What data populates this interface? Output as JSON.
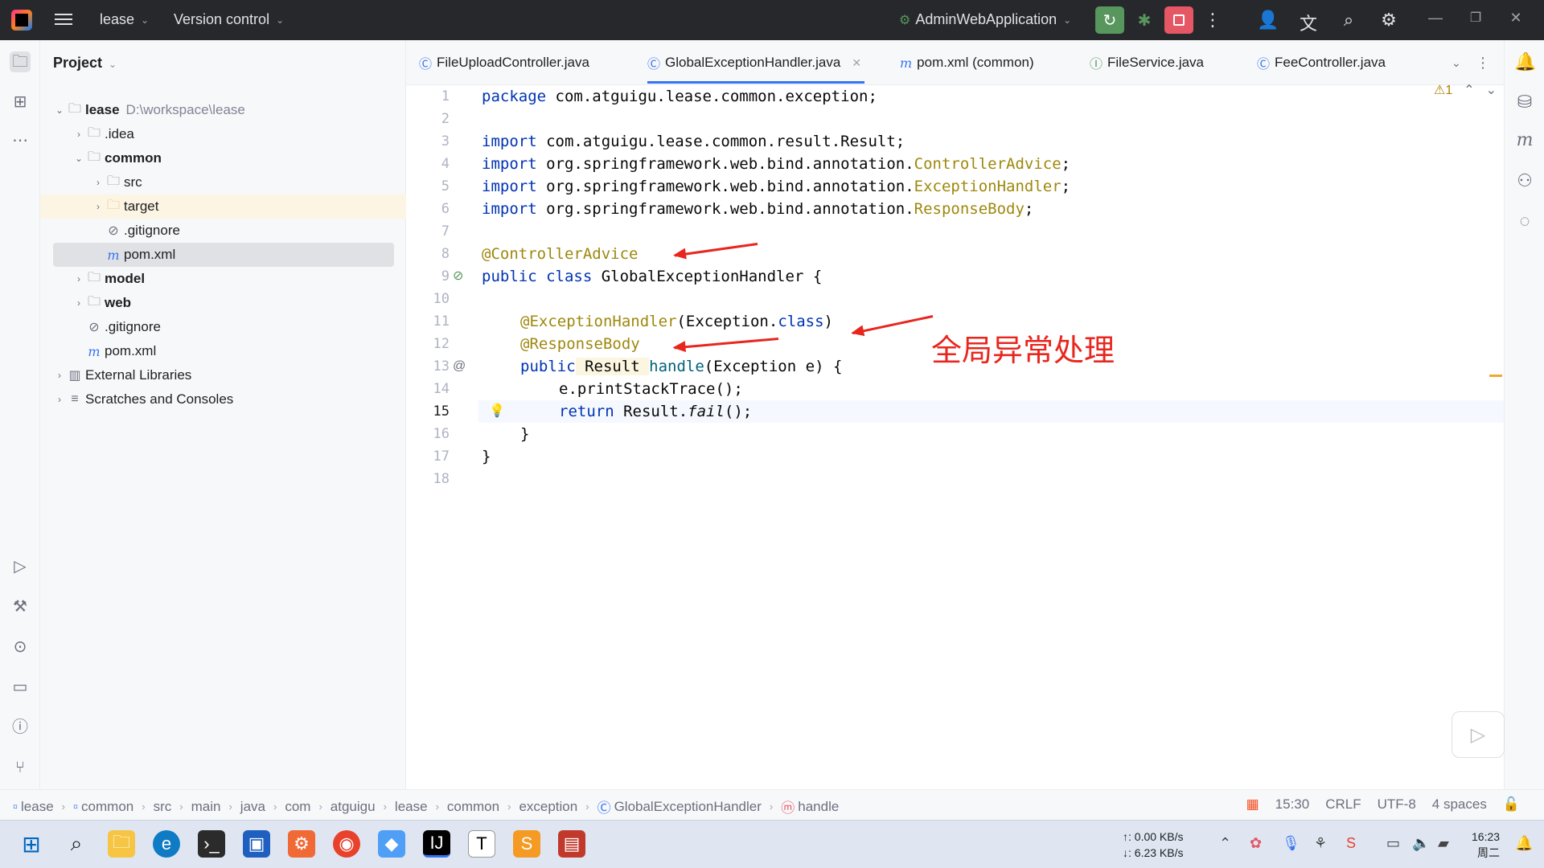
{
  "titlebar": {
    "project": "lease",
    "vcs": "Version control",
    "run_config": "AdminWebApplication"
  },
  "project_panel": {
    "title": "Project",
    "tree": [
      {
        "label": "lease",
        "path": "D:\\workspace\\lease",
        "level": 0,
        "expanded": true,
        "bold": true,
        "icon": "module-folder-icon"
      },
      {
        "label": ".idea",
        "level": 1,
        "expanded": false,
        "icon": "folder-icon"
      },
      {
        "label": "common",
        "level": 1,
        "expanded": true,
        "bold": true,
        "icon": "module-folder-icon"
      },
      {
        "label": "src",
        "level": 2,
        "expanded": false,
        "icon": "folder-icon"
      },
      {
        "label": "target",
        "level": 2,
        "expanded": false,
        "icon": "folder-excluded-icon"
      },
      {
        "label": ".gitignore",
        "level": 2,
        "icon": "ignore-file-icon"
      },
      {
        "label": "pom.xml",
        "level": 2,
        "icon": "maven-icon"
      },
      {
        "label": "model",
        "level": 1,
        "expanded": false,
        "bold": true,
        "icon": "module-folder-icon"
      },
      {
        "label": "web",
        "level": 1,
        "expanded": false,
        "bold": true,
        "icon": "module-folder-icon"
      },
      {
        "label": ".gitignore",
        "level": 1,
        "icon": "ignore-file-icon"
      },
      {
        "label": "pom.xml",
        "level": 1,
        "icon": "maven-icon"
      },
      {
        "label": "External Libraries",
        "level": 0,
        "expanded": false,
        "icon": "library-icon"
      },
      {
        "label": "Scratches and Consoles",
        "level": 0,
        "expanded": false,
        "icon": "scratches-icon"
      }
    ]
  },
  "tabs": [
    {
      "label": "FileUploadController.java",
      "icon": "class-icon"
    },
    {
      "label": "GlobalExceptionHandler.java",
      "icon": "class-icon",
      "active": true
    },
    {
      "label": "pom.xml (common)",
      "icon": "maven-icon"
    },
    {
      "label": "FileService.java",
      "icon": "interface-icon"
    },
    {
      "label": "FeeController.java",
      "icon": "class-icon"
    }
  ],
  "editor": {
    "line_numbers": [
      "1",
      "2",
      "3",
      "4",
      "5",
      "6",
      "7",
      "8",
      "9",
      "10",
      "11",
      "12",
      "13",
      "14",
      "15",
      "16",
      "17",
      "18"
    ],
    "warning_count": "1",
    "code": {
      "l1_kw": "package",
      "l1_rest": " com.atguigu.lease.common.exception;",
      "l3_kw": "import",
      "l3_rest": " com.atguigu.lease.common.result.Result;",
      "l4_kw": "import",
      "l4_rest": " org.springframework.web.bind.annotation.",
      "l4_cls": "ControllerAdvice",
      "l5_kw": "import",
      "l5_rest": " org.springframework.web.bind.annotation.",
      "l5_cls": "ExceptionHandler",
      "l6_kw": "import",
      "l6_rest": " org.springframework.web.bind.annotation.",
      "l6_cls": "ResponseBody",
      "l8_ann": "@ControllerAdvice",
      "l9_kw": "public class",
      "l9_rest": " GlobalExceptionHandler {",
      "l11_ann": "@ExceptionHandler",
      "l11_rest": "(Exception.",
      "l11_kw": "class",
      "l11_end": ")",
      "l12_ann": "@ResponseBody",
      "l13_kw": "public",
      "l13_type": " Result ",
      "l13_fn": "handle",
      "l13_rest": "(Exception e) {",
      "l14": "e.printStackTrace();",
      "l15_kw": "return",
      "l15_rest": " Result.",
      "l15_it": "fail",
      "l15_end": "();",
      "l16": "}",
      "l17": "}"
    },
    "annotation_text": "全局异常处理"
  },
  "statusbar": {
    "breadcrumbs": [
      "lease",
      "common",
      "src",
      "main",
      "java",
      "com",
      "atguigu",
      "lease",
      "common",
      "exception",
      "GlobalExceptionHandler",
      "handle"
    ],
    "position": "15:30",
    "line_sep": "CRLF",
    "encoding": "UTF-8",
    "indent": "4 spaces"
  },
  "taskbar": {
    "upload": "↑: 0.00 KB/s",
    "download": "↓: 6.23 KB/s",
    "time": "16:23",
    "day": "周二"
  },
  "colors": {
    "keyword": "#0033b3",
    "annotation": "#9e880d",
    "accent": "#3574f0",
    "red_annotation": "#e8261e"
  }
}
